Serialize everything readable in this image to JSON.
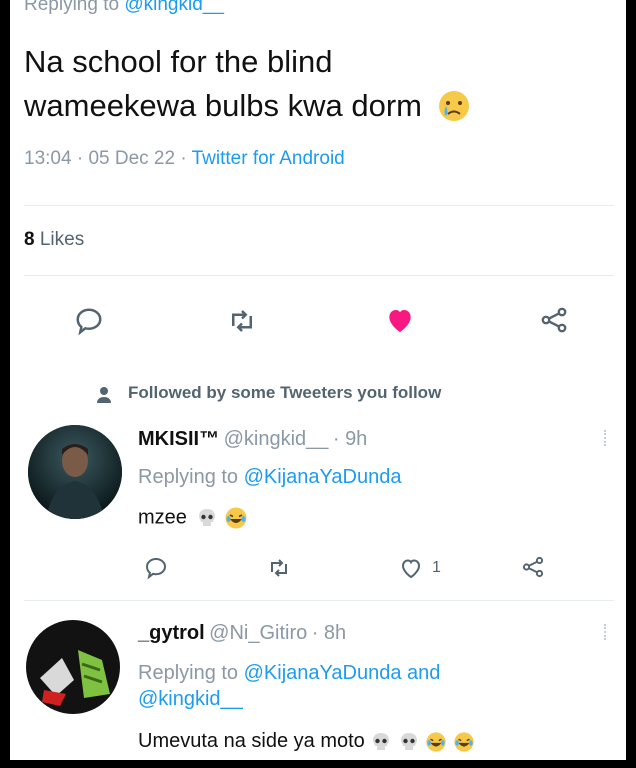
{
  "main_tweet": {
    "replying_prefix": "Replying to",
    "replying_handle": "@kingkid__",
    "text_line1": "Na school for the blind",
    "text_line2": "wameekewa bulbs kwa dorm",
    "emoji": "crying-face-emoji",
    "time": "13:04",
    "date": "05 Dec 22",
    "source": "Twitter for Android",
    "likes_count": "8",
    "likes_label": "Likes",
    "liked": true,
    "like_color": "#f91880"
  },
  "followed_notice": "Followed by some Tweeters you follow",
  "replies": [
    {
      "name": "MKISII™",
      "handle": "@kingkid__",
      "time": "9h",
      "replying_prefix": "Replying to",
      "replying_to": "@KijanaYaDunda",
      "text": "mzee",
      "emojis": [
        "skull-emoji",
        "laughing-emoji"
      ],
      "like_count": "1"
    },
    {
      "name": "_gytrol",
      "handle": "@Ni_Gitiro",
      "time": "8h",
      "replying_prefix": "Replying to",
      "replying_to": "@KijanaYaDunda",
      "replying_and": "and",
      "replying_to_2": "@kingkid__",
      "text": "Umevuta na side ya moto",
      "emojis": [
        "skull-emoji",
        "skull-emoji",
        "laughing-emoji",
        "laughing-emoji"
      ]
    }
  ],
  "colors": {
    "link": "#1d9bf0",
    "muted": "#8b98a5",
    "like": "#f91880"
  }
}
